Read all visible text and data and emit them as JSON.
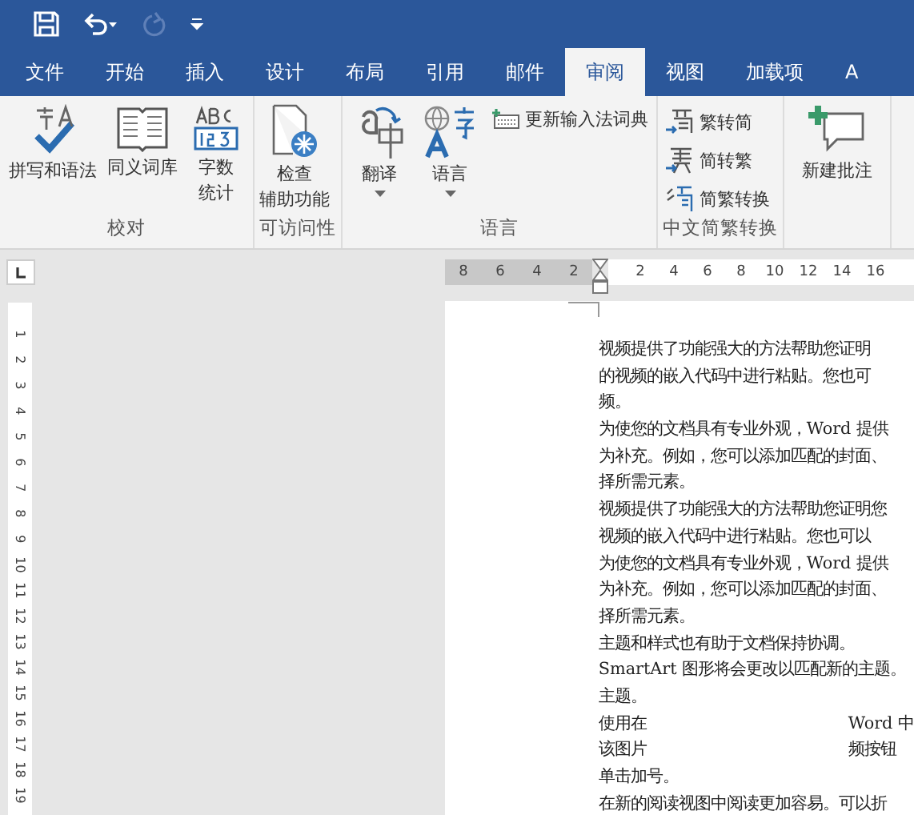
{
  "quick_access": [
    {
      "kind": "save",
      "disabled": false
    },
    {
      "kind": "undo",
      "disabled": false
    },
    {
      "kind": "redo",
      "disabled": true
    },
    {
      "kind": "customize",
      "disabled": false
    }
  ],
  "tabs": [
    {
      "label": "文件",
      "selected": false
    },
    {
      "label": "开始",
      "selected": false
    },
    {
      "label": "插入",
      "selected": false
    },
    {
      "label": "设计",
      "selected": false
    },
    {
      "label": "布局",
      "selected": false
    },
    {
      "label": "引用",
      "selected": false
    },
    {
      "label": "邮件",
      "selected": false
    },
    {
      "label": "审阅",
      "selected": true
    },
    {
      "label": "视图",
      "selected": false
    },
    {
      "label": "加载项",
      "selected": false
    },
    {
      "label": "A",
      "selected": false
    }
  ],
  "ribbon_groups": [
    {
      "label": "校对",
      "buttons": [
        {
          "kind": "spelling",
          "label": [
            "拼写和语法"
          ]
        },
        {
          "kind": "thesaurus",
          "label": [
            "同义词库"
          ]
        },
        {
          "kind": "wordcount",
          "label": [
            "字数",
            "统计"
          ]
        }
      ]
    },
    {
      "label": "可访问性",
      "buttons": [
        {
          "kind": "accessibility",
          "label": [
            "检查",
            "辅助功能"
          ]
        }
      ]
    },
    {
      "label": "语言",
      "buttons": [
        {
          "kind": "translate",
          "label": [
            "翻译"
          ],
          "dropdown": true
        },
        {
          "kind": "language",
          "label": [
            "语言"
          ],
          "dropdown": true
        }
      ],
      "small_buttons": [
        {
          "kind": "ime",
          "label": "更新输入法词典"
        }
      ]
    },
    {
      "label": "中文简繁转换",
      "small_buttons": [
        {
          "kind": "to_simplified",
          "label": "繁转简"
        },
        {
          "kind": "to_traditional",
          "label": "简转繁"
        },
        {
          "kind": "convert",
          "label": "简繁转换"
        }
      ]
    },
    {
      "buttons": [
        {
          "kind": "comment",
          "label": [
            "新建批注"
          ]
        }
      ]
    }
  ],
  "horizontal_ruler": {
    "left_ticks": [
      "8",
      "6",
      "4",
      "2"
    ],
    "right_ticks": [
      "2",
      "4",
      "6",
      "8",
      "10",
      "12",
      "14",
      "16"
    ]
  },
  "vertical_ruler": {
    "ticks": [
      "1",
      "2",
      "3",
      "4",
      "5",
      "6",
      "7",
      "8",
      "9",
      "10",
      "11",
      "12",
      "13",
      "14",
      "15",
      "16",
      "17",
      "18",
      "19"
    ]
  },
  "document": {
    "lines": [
      {
        "segments": [
          "视频提供了功能强大的方法帮助您证明"
        ]
      },
      {
        "segments": [
          "的视频的嵌入代码中进行粘贴。您也可"
        ]
      },
      {
        "segments": [
          "频。"
        ]
      },
      {
        "segments": [
          "为使您的文档具有专业外观，Word 提供"
        ]
      },
      {
        "segments": [
          "为补充。例如，您可以添加匹配的封面、"
        ]
      },
      {
        "segments": [
          "择所需元素。"
        ]
      },
      {
        "segments": [
          "视频提供了功能强大的方法帮助您证明您"
        ]
      },
      {
        "segments": [
          "视频的嵌入代码中进行粘贴。您也可以"
        ]
      },
      {
        "segments": [
          "为使您的文档具有专业外观，Word 提供"
        ]
      },
      {
        "segments": [
          "为补充。例如，您可以添加匹配的封面、"
        ]
      },
      {
        "segments": [
          "择所需元素。"
        ]
      },
      {
        "segments": [
          "主题和样式也有助于文档保持协调。"
        ]
      },
      {
        "segments": [
          "SmartArt 图形将会更改以匹配新的主题。"
        ]
      },
      {
        "segments": [
          "主题。"
        ]
      },
      {
        "segments": [
          "使用在",
          "Word 中"
        ]
      },
      {
        "segments": [
          "该图片",
          "频按钮"
        ]
      },
      {
        "segments": [
          "单击加号。"
        ]
      },
      {
        "segments": [
          "在新的阅读视图中阅读更加容易。可以折"
        ]
      }
    ]
  }
}
